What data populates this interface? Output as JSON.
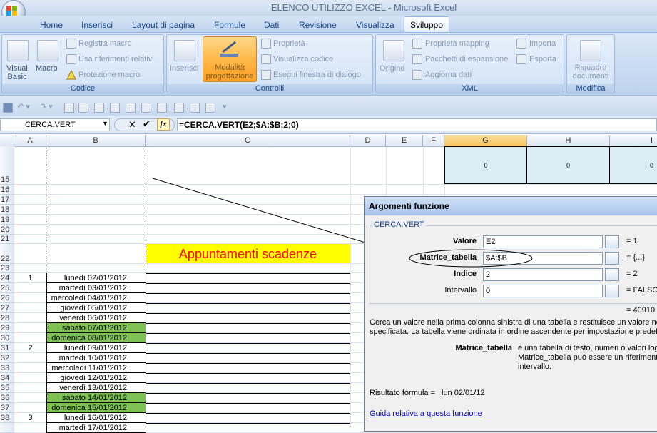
{
  "window": {
    "title": "ELENCO UTILIZZO EXCEL - Microsoft Excel"
  },
  "tabs": [
    "Home",
    "Inserisci",
    "Layout di pagina",
    "Formule",
    "Dati",
    "Revisione",
    "Visualizza",
    "Sviluppo"
  ],
  "active_tab": "Sviluppo",
  "ribbon": {
    "codice": {
      "label": "Codice",
      "visual_basic": "Visual Basic",
      "macro": "Macro",
      "registra": "Registra macro",
      "riferimenti": "Usa riferimenti relativi",
      "protezione": "Protezione macro"
    },
    "controlli": {
      "label": "Controlli",
      "inserisci": "Inserisci",
      "modalita_1": "Modalità",
      "modalita_2": "progettazione",
      "proprieta": "Proprietà",
      "visualizza_codice": "Visualizza codice",
      "esegui": "Esegui finestra di dialogo"
    },
    "xml": {
      "label": "XML",
      "origine": "Origine",
      "proprieta_mapping": "Proprietà mapping",
      "pacchetti": "Pacchetti di espansione",
      "aggiorna": "Aggiorna dati",
      "importa": "Importa",
      "esporta": "Esporta"
    },
    "modifica": {
      "label": "Modifica",
      "riquadro_1": "Riquadro",
      "riquadro_2": "documenti"
    }
  },
  "formula_bar": {
    "name_box": "CERCA.VERT",
    "fx": "fx",
    "formula": "=CERCA.VERT(E2;$A:$B;2;0)"
  },
  "columns": [
    "A",
    "B",
    "C",
    "D",
    "E",
    "F",
    "G",
    "H",
    "I"
  ],
  "row15": {
    "g": "0",
    "h": "0",
    "i": "0"
  },
  "sheet_title": "Appuntamenti scadenze",
  "rows": [
    {
      "n": "15",
      "a": "",
      "b": ""
    },
    {
      "n": "16",
      "a": "",
      "b": ""
    },
    {
      "n": "17",
      "a": "",
      "b": ""
    },
    {
      "n": "18",
      "a": "",
      "b": ""
    },
    {
      "n": "19",
      "a": "",
      "b": ""
    },
    {
      "n": "20",
      "a": "",
      "b": ""
    },
    {
      "n": "21",
      "a": "",
      "b": ""
    },
    {
      "n": "22",
      "a": "",
      "b": ""
    },
    {
      "n": "23",
      "a": "",
      "b": ""
    },
    {
      "n": "24",
      "a": "1",
      "b": "lunedì 02/01/2012"
    },
    {
      "n": "25",
      "a": "",
      "b": "martedì 03/01/2012"
    },
    {
      "n": "26",
      "a": "",
      "b": "mercoledì 04/01/2012"
    },
    {
      "n": "27",
      "a": "",
      "b": "giovedì 05/01/2012"
    },
    {
      "n": "28",
      "a": "",
      "b": "venerdì 06/01/2012"
    },
    {
      "n": "29",
      "a": "",
      "b": "sabato 07/01/2012"
    },
    {
      "n": "30",
      "a": "",
      "b": "domenica 08/01/2012"
    },
    {
      "n": "31",
      "a": "2",
      "b": "lunedì 09/01/2012"
    },
    {
      "n": "32",
      "a": "",
      "b": "martedì 10/01/2012"
    },
    {
      "n": "33",
      "a": "",
      "b": "mercoledì 11/01/2012"
    },
    {
      "n": "34",
      "a": "",
      "b": "giovedì 12/01/2012"
    },
    {
      "n": "35",
      "a": "",
      "b": "venerdì 13/01/2012"
    },
    {
      "n": "36",
      "a": "",
      "b": "sabato 14/01/2012"
    },
    {
      "n": "37",
      "a": "",
      "b": "domenica 15/01/2012"
    },
    {
      "n": "38",
      "a": "3",
      "b": "lunedì 16/01/2012"
    },
    {
      "n": "",
      "a": "",
      "b": "martedì 17/01/2012"
    }
  ],
  "dialog": {
    "title": "Argomenti funzione",
    "function": "CERCA.VERT",
    "args": [
      {
        "label": "Valore",
        "value": "E2",
        "result": "1"
      },
      {
        "label": "Matrice_tabella",
        "value": "$A:$B",
        "result": "{...}"
      },
      {
        "label": "Indice",
        "value": "2",
        "result": "2"
      },
      {
        "label": "Intervallo",
        "value": "0",
        "result": "FALSO"
      }
    ],
    "overall_result": "40910",
    "description_1": "Cerca un valore nella prima colonna sinistra di una tabella e restituisce un valore nella",
    "description_2": "specificata. La tabella viene ordinata in ordine ascendente per impostazione predefinita",
    "arg_help_name": "Matrice_tabella",
    "arg_help_1": "è una tabella di testo, numeri o valori logici",
    "arg_help_2": "Matrice_tabella può essere un riferimento a",
    "arg_help_3": "intervallo.",
    "formula_result_label": "Risultato formula =",
    "formula_result_value": "lun 02/01/12",
    "help_link": "Guida relativa a questa funzione"
  },
  "colors": {
    "accent": "#15428b",
    "green_cell": "#7ec254",
    "yellow_cell": "#ffff00",
    "title_red": "#ff0000",
    "selected_col": "#f7c25b"
  }
}
